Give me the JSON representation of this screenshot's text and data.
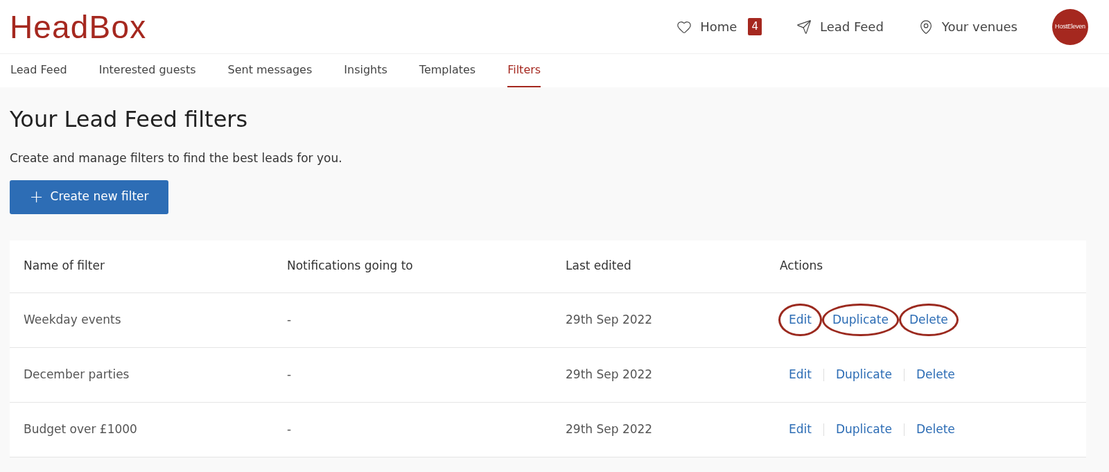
{
  "logo": "HeadBox",
  "top_nav": [
    {
      "kind": "heart",
      "label": "Home",
      "badge": "4"
    },
    {
      "kind": "send",
      "label": "Lead Feed"
    },
    {
      "kind": "pin",
      "label": "Your venues"
    }
  ],
  "avatar": "HostEleven",
  "tabs": [
    {
      "label": "Lead Feed",
      "selected": false
    },
    {
      "label": "Interested guests",
      "selected": false
    },
    {
      "label": "Sent messages",
      "selected": false
    },
    {
      "label": "Insights",
      "selected": false
    },
    {
      "label": "Templates",
      "selected": false
    },
    {
      "label": "Filters",
      "selected": true
    }
  ],
  "title": "Your Lead Feed filters",
  "subtitle": "Create and manage filters to find the best leads for you.",
  "create_button": {
    "icon": "+",
    "label": "Create new filter"
  },
  "table": {
    "columns": [
      "Name of filter",
      "Notifications going to",
      "Last edited",
      "Actions"
    ],
    "rows": [
      {
        "name": "Weekday events",
        "notifications": "-",
        "last_edited": "29th Sep 2022",
        "actions": [
          {
            "label": "Edit",
            "circled": true
          },
          {
            "label": "Duplicate",
            "circled": true
          },
          {
            "label": "Delete",
            "circled": true
          }
        ]
      },
      {
        "name": "December parties",
        "notifications": "-",
        "last_edited": "29th Sep 2022",
        "actions": [
          {
            "label": "Edit",
            "circled": false
          },
          {
            "label": "Duplicate",
            "circled": false
          },
          {
            "label": "Delete",
            "circled": false
          }
        ]
      },
      {
        "name": "Budget over £1000",
        "notifications": "-",
        "last_edited": "29th Sep 2022",
        "actions": [
          {
            "label": "Edit",
            "circled": false
          },
          {
            "label": "Duplicate",
            "circled": false
          },
          {
            "label": "Delete",
            "circled": false
          }
        ]
      }
    ]
  }
}
